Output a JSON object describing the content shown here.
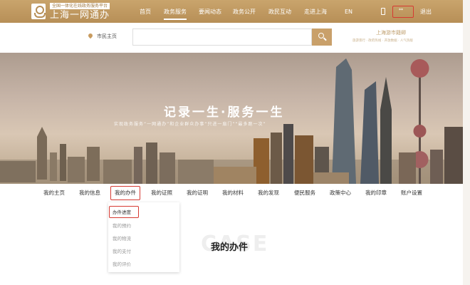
{
  "header": {
    "logo_subtitle": "全国一体化在线政务服务平台",
    "logo_title": "上海一网通办",
    "nav": [
      "首页",
      "政务服务",
      "要闻动态",
      "政务公开",
      "政民互动",
      "走进上海",
      "EN"
    ],
    "active_nav": "政务服务",
    "user_name": "**",
    "logout": "退出"
  },
  "search": {
    "location_label": "市民主页",
    "placeholder": "",
    "mayor_title": "上海游市籍卿",
    "mayor_tags": "旅游景行 · 政府热线 · 开放数据 · 人气热版"
  },
  "hero": {
    "title": "记录一生·服务一生",
    "subtitle": "实现政务服务“一网通办”和企业群众办事“只进一扇门”“最多跑一次”"
  },
  "subnav": {
    "items": [
      "我的主页",
      "我的信息",
      "我的办件",
      "我的证照",
      "我的证明",
      "我的材料",
      "我的发现",
      "便民服务",
      "政策中心",
      "我的印章",
      "账户设置"
    ],
    "highlighted": "我的办件"
  },
  "dropdown": {
    "items": [
      "办件进度",
      "我的预约",
      "我的物流",
      "我的支付",
      "我的评价"
    ],
    "highlighted": "办件进度"
  },
  "page": {
    "watermark": "CASE",
    "title": "我的办件"
  },
  "colors": {
    "gold": "#b78f57",
    "highlight_red": "#d63a32",
    "button_gold": "#c9a06a"
  }
}
